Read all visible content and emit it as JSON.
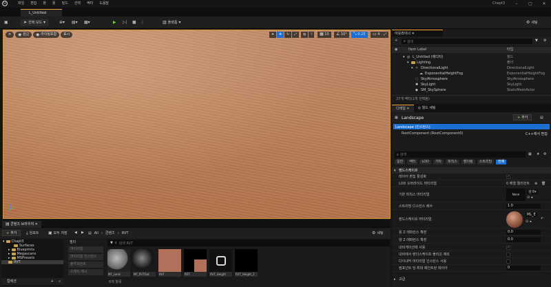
{
  "menubar": {
    "logo": "U",
    "items": [
      "파일",
      "편집",
      "창",
      "툴",
      "빌드",
      "선택",
      "액터",
      "도움말"
    ],
    "project": "Chapt3"
  },
  "tab": {
    "title": "L_Untitled"
  },
  "toolbar": {
    "save_icon": "save-icon",
    "select_mode": "선택 모드",
    "platforms": "플랫폼",
    "settings": "세팅"
  },
  "viewport": {
    "perspective": "원근",
    "lit": "라이팅포함",
    "show": "표시",
    "grid": "10",
    "angle": "10°",
    "scale": "0.25",
    "cam": "4"
  },
  "content_browser": {
    "tab": "콘텐츠 브라우저",
    "add": "추가",
    "import": "임포트",
    "save_all": "모두 저장",
    "path": [
      "All",
      "콘텐츠",
      "RVT"
    ],
    "settings": "세팅",
    "filter_label": "필터",
    "search_placeholder": "검색 RVT",
    "item_count": "6개 항목",
    "bottom_label": "컬렉션",
    "tree": [
      {
        "label": "Chapt3",
        "depth": 0
      },
      {
        "label": "Surfaces",
        "depth": 2
      },
      {
        "label": "Blueprints",
        "depth": 1
      },
      {
        "label": "Megascans",
        "depth": 1
      },
      {
        "label": "MSPresets",
        "depth": 1
      },
      {
        "label": "RVT",
        "depth": 1
      }
    ],
    "filters": [
      "머티리얼",
      "머티리얼 인스턴스",
      "블루프린트",
      "스태틱 메시"
    ],
    "assets": [
      {
        "label": "MF_Land"
      },
      {
        "label": "MF_RVTOut"
      },
      {
        "label": "RVT"
      },
      {
        "label": "RVT"
      },
      {
        "label": "RVT_Height"
      },
      {
        "label": "RVT_Height_2"
      }
    ]
  },
  "outliner": {
    "tab": "아웃라이너",
    "search_placeholder": "검색",
    "col_label": "Item Label",
    "col_type": "타입",
    "rows": [
      {
        "label": "L_Untitled (에디터)",
        "type": "월드",
        "depth": 0
      },
      {
        "label": "Lighting",
        "type": "폴더",
        "depth": 1
      },
      {
        "label": "DirectionalLight",
        "type": "DirectionalLight",
        "depth": 2
      },
      {
        "label": "ExponentialHeightFog",
        "type": "ExponentialHeightFog",
        "depth": 3
      },
      {
        "label": "SkyAtmosphere",
        "type": "SkyAtmosphere",
        "depth": 3
      },
      {
        "label": "SkyLight",
        "type": "SkyLight",
        "depth": 3
      },
      {
        "label": "SM_SkySphere",
        "type": "StaticMeshActor",
        "depth": 3
      }
    ],
    "footer": "27개 액터(1개 선택됨)"
  },
  "details": {
    "tab_details": "디테일",
    "tab_world": "월드 세팅",
    "title": "Landscape",
    "add": "추가",
    "instance": "Landscape (인스턴스)",
    "root": "RootComponent (RootComponent0)",
    "cpp_edit": "C++에서 편집",
    "search_placeholder": "검색",
    "filters": [
      "일반",
      "액터",
      "LOD",
      "기타",
      "피직스",
      "렌더링",
      "스트리밍",
      "전체"
    ],
    "section": "랜드스케이프",
    "props": [
      {
        "k": "레이어 편집 활성화",
        "v": "✓",
        "kind": "check"
      },
      {
        "k": "LOD 오버라이드 머티리얼",
        "v": "0 배열 엘리먼트",
        "kind": "text"
      },
      {
        "k": "기본 피직스 머티리얼",
        "v": "None",
        "kind": "asset"
      },
      {
        "k": "스트리밍 디스턴스 배수",
        "v": "1.0",
        "kind": "num"
      },
      {
        "k": "랜드스케이프 머티리얼",
        "v": "ML_E",
        "kind": "mat"
      },
      {
        "k": "용 Z 레퍼런스 확장",
        "v": "0.0",
        "kind": "num"
      },
      {
        "k": "양 Z 레퍼런스 확장",
        "v": "0.0",
        "kind": "num"
      },
      {
        "k": "내비게이션에 사용",
        "v": "✓",
        "kind": "check"
      },
      {
        "k": "내비에서 렌더스케이프 폴리곤 제외",
        "v": "",
        "kind": "check"
      },
      {
        "k": "다이내믹 머티리얼 인스턴스 사용",
        "v": "",
        "kind": "check"
      },
      {
        "k": "컴포넌트 당 최대 페인트된 레이어",
        "v": "0",
        "kind": "num"
      }
    ],
    "advanced": "고급"
  },
  "colors": {
    "accent": "#f2a83c",
    "select": "#1a6fd1",
    "green": "#6fd34f"
  }
}
